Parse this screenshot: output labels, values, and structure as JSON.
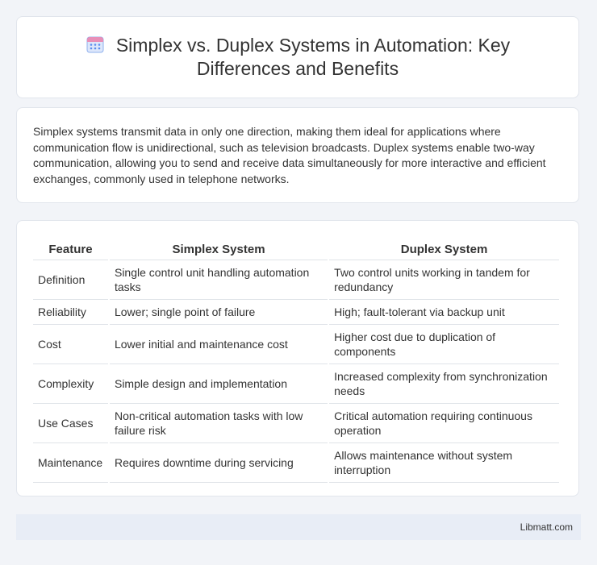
{
  "header": {
    "title": "Simplex vs. Duplex Systems in Automation: Key Differences and Benefits",
    "icon": "calendar-icon"
  },
  "intro": {
    "text": "Simplex systems transmit data in only one direction, making them ideal for applications where communication flow is unidirectional, such as television broadcasts. Duplex systems enable two-way communication, allowing you to send and receive data simultaneously for more interactive and efficient exchanges, commonly used in telephone networks."
  },
  "table": {
    "headers": [
      "Feature",
      "Simplex System",
      "Duplex System"
    ],
    "rows": [
      [
        "Definition",
        "Single control unit handling automation tasks",
        "Two control units working in tandem for redundancy"
      ],
      [
        "Reliability",
        "Lower; single point of failure",
        "High; fault-tolerant via backup unit"
      ],
      [
        "Cost",
        "Lower initial and maintenance cost",
        "Higher cost due to duplication of components"
      ],
      [
        "Complexity",
        "Simple design and implementation",
        "Increased complexity from synchronization needs"
      ],
      [
        "Use Cases",
        "Non-critical automation tasks with low failure risk",
        "Critical automation requiring continuous operation"
      ],
      [
        "Maintenance",
        "Requires downtime during servicing",
        "Allows maintenance without system interruption"
      ]
    ]
  },
  "footer": {
    "text": "Libmatt.com"
  },
  "colors": {
    "background": "#f2f4f8",
    "card": "#ffffff",
    "footer_bg": "#e8edf6",
    "icon_blue": "#5b8def",
    "icon_pink": "#e88fb8"
  }
}
